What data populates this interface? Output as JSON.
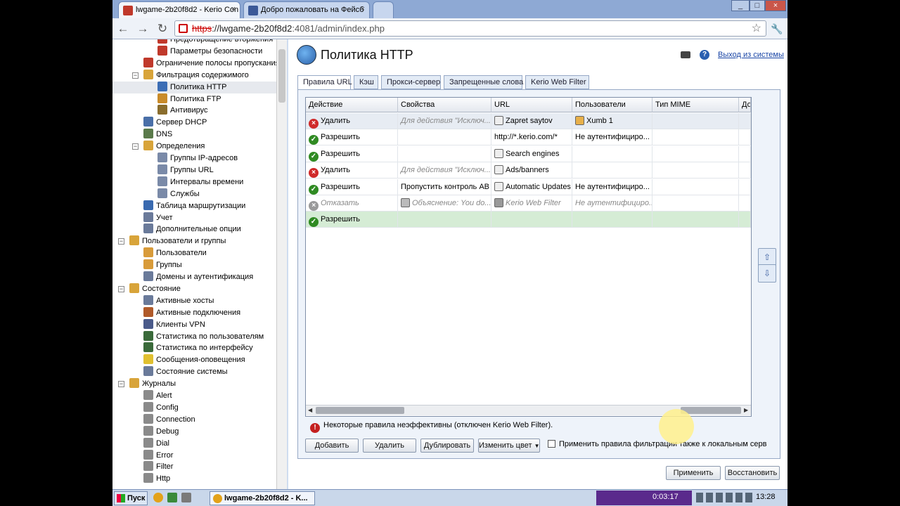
{
  "browser": {
    "tabs": [
      {
        "title": "lwgame-2b20f8d2 - Kerio Con",
        "favicon": "kerio-icon"
      },
      {
        "title": "Добро пожаловать на Фейсб",
        "favicon": "facebook-icon"
      }
    ],
    "url": {
      "scheme": "https",
      "host": "://lwgame-2b20f8d2",
      "rest": ":4081/admin/index.php"
    },
    "window_controls": [
      "_",
      "□",
      "×"
    ]
  },
  "sidebar": {
    "items": [
      {
        "label": "Предотвращение вторжения",
        "icon": "shield-icon",
        "indent": 2,
        "color": "#c0392b"
      },
      {
        "label": "Параметры безопасности",
        "icon": "lock-icon",
        "indent": 2,
        "color": "#c0392b"
      },
      {
        "label": "Ограничение полосы пропускания",
        "icon": "gauge-icon",
        "indent": 1,
        "color": "#c0392b"
      },
      {
        "label": "Фильтрация содержимого",
        "icon": "folder-icon",
        "indent": 1,
        "color": "#d8a43a",
        "toggle": "−"
      },
      {
        "label": "Политика HTTP",
        "icon": "globe-icon",
        "indent": 2,
        "color": "#3b6db5",
        "selected": true
      },
      {
        "label": "Политика FTP",
        "icon": "ftp-icon",
        "indent": 2,
        "color": "#c98b2a"
      },
      {
        "label": "Антивирус",
        "icon": "antivirus-icon",
        "indent": 2,
        "color": "#8a6d2d"
      },
      {
        "label": "Сервер DHCP",
        "icon": "dhcp-icon",
        "indent": 1,
        "color": "#4a6fa8"
      },
      {
        "label": "DNS",
        "icon": "dns-icon",
        "indent": 1,
        "color": "#5a7a4a"
      },
      {
        "label": "Определения",
        "icon": "folder-icon",
        "indent": 1,
        "color": "#d8a43a",
        "toggle": "−"
      },
      {
        "label": "Группы IP-адресов",
        "icon": "ip-group-icon",
        "indent": 2,
        "color": "#7a8aa8"
      },
      {
        "label": "Группы URL",
        "icon": "url-group-icon",
        "indent": 2,
        "color": "#7a8aa8"
      },
      {
        "label": "Интервалы времени",
        "icon": "clock-icon",
        "indent": 2,
        "color": "#7a8aa8"
      },
      {
        "label": "Службы",
        "icon": "services-icon",
        "indent": 2,
        "color": "#7a8aa8"
      },
      {
        "label": "Таблица маршрутизации",
        "icon": "routing-icon",
        "indent": 1,
        "color": "#3a6ab0"
      },
      {
        "label": "Учет",
        "icon": "accounting-icon",
        "indent": 1,
        "color": "#6a7a9a"
      },
      {
        "label": "Дополнительные опции",
        "icon": "options-icon",
        "indent": 1,
        "color": "#6a7a9a"
      },
      {
        "label": "Пользователи и группы",
        "icon": "folder-icon",
        "indent": 0,
        "color": "#d8a43a",
        "toggle": "−"
      },
      {
        "label": "Пользователи",
        "icon": "user-icon",
        "indent": 1,
        "color": "#d89b3a"
      },
      {
        "label": "Группы",
        "icon": "group-icon",
        "indent": 1,
        "color": "#d89b3a"
      },
      {
        "label": "Домены и аутентификация",
        "icon": "domain-icon",
        "indent": 1,
        "color": "#6a7a9a"
      },
      {
        "label": "Состояние",
        "icon": "folder-icon",
        "indent": 0,
        "color": "#d8a43a",
        "toggle": "−"
      },
      {
        "label": "Активные хосты",
        "icon": "hosts-icon",
        "indent": 1,
        "color": "#6a7a9a"
      },
      {
        "label": "Активные подключения",
        "icon": "connections-icon",
        "indent": 1,
        "color": "#b05a2a"
      },
      {
        "label": "Клиенты VPN",
        "icon": "vpn-icon",
        "indent": 1,
        "color": "#4a5a8a"
      },
      {
        "label": "Статистика по пользователям",
        "icon": "user-stats-icon",
        "indent": 1,
        "color": "#3a6a3a"
      },
      {
        "label": "Статистика по интерфейсу",
        "icon": "interface-stats-icon",
        "indent": 1,
        "color": "#3a6a3a"
      },
      {
        "label": "Сообщения-оповещения",
        "icon": "alert-icon",
        "indent": 1,
        "color": "#e0c030"
      },
      {
        "label": "Состояние системы",
        "icon": "system-icon",
        "indent": 1,
        "color": "#6a7a9a"
      },
      {
        "label": "Журналы",
        "icon": "folder-icon",
        "indent": 0,
        "color": "#d8a43a",
        "toggle": "−"
      },
      {
        "label": "Alert",
        "icon": "log-icon",
        "indent": 1,
        "color": "#8a8a8a"
      },
      {
        "label": "Config",
        "icon": "log-icon",
        "indent": 1,
        "color": "#8a8a8a"
      },
      {
        "label": "Connection",
        "icon": "log-icon",
        "indent": 1,
        "color": "#8a8a8a"
      },
      {
        "label": "Debug",
        "icon": "log-icon",
        "indent": 1,
        "color": "#8a8a8a"
      },
      {
        "label": "Dial",
        "icon": "log-icon",
        "indent": 1,
        "color": "#8a8a8a"
      },
      {
        "label": "Error",
        "icon": "log-icon",
        "indent": 1,
        "color": "#8a8a8a"
      },
      {
        "label": "Filter",
        "icon": "log-icon",
        "indent": 1,
        "color": "#8a8a8a"
      },
      {
        "label": "Http",
        "icon": "log-icon",
        "indent": 1,
        "color": "#8a8a8a"
      }
    ]
  },
  "page": {
    "title": "Политика HTTP",
    "logout": "Выход из системы",
    "tabs": [
      "Правила URL",
      "Кэш",
      "Прокси-сервер",
      "Запрещенные слова",
      "Kerio Web Filter"
    ],
    "active_tab": 0
  },
  "table": {
    "columns": [
      "Действие",
      "Свойства",
      "URL",
      "Пользователи",
      "Тип MIME",
      "До"
    ],
    "rows": [
      {
        "action": "Удалить",
        "status": "deny",
        "props": "Для действия \"Исключ...",
        "props_italic": true,
        "url": "Zapret saytov",
        "url_icon": "url-group-icon",
        "users": "Хumb 1",
        "users_icon": "user-group-icon",
        "users_italic": false
      },
      {
        "action": "Разрешить",
        "status": "allow",
        "props": "",
        "url": "http://*.kerio.com/*",
        "url_icon": "",
        "users": "Не аутентифициро...",
        "users_icon": ""
      },
      {
        "action": "Разрешить",
        "status": "allow",
        "props": "",
        "url": "Search engines",
        "url_icon": "url-group-icon",
        "users": "",
        "users_icon": ""
      },
      {
        "action": "Удалить",
        "status": "deny",
        "props": "Для действия \"Исключ...",
        "props_italic": true,
        "url": "Ads/banners",
        "url_icon": "url-group-icon",
        "users": "",
        "users_icon": ""
      },
      {
        "action": "Разрешить",
        "status": "allow",
        "props": "Пропустить контроль АВ",
        "url": "Automatic Updates",
        "url_icon": "url-group-icon",
        "users": "Не аутентифициро...",
        "users_icon": ""
      },
      {
        "action": "Отказать",
        "status": "disabled",
        "props": "Объяснение: You do...",
        "props_italic": true,
        "props_icon": "key-icon",
        "url": "Kerio Web Filter",
        "url_icon": "filter-icon",
        "url_italic": true,
        "users": "Не аутентифициро...",
        "users_italic": true
      },
      {
        "action": "Разрешить",
        "status": "allow",
        "props": "",
        "url": "",
        "users": ""
      }
    ]
  },
  "warning": "Некоторые правила неэффективны (отключен Kerio Web Filter).",
  "buttons": {
    "add": "Добавить",
    "delete": "Удалить",
    "duplicate": "Дублировать",
    "change_color": "Изменить цвет",
    "apply": "Применить",
    "restore": "Восстановить"
  },
  "checkbox_local": "Применить правила фильтрации также к локальным серв",
  "taskbar": {
    "start": "Пуск",
    "task": "lwgame-2b20f8d2 - K...",
    "timer": "0:03:17",
    "clock": "13:28"
  },
  "colors": {
    "allow": "#2f8a22",
    "deny": "#cf2a2a",
    "disabled": "#9a9a9a",
    "selected_row": "#d5ecd5",
    "accent": "#1a46a6"
  }
}
